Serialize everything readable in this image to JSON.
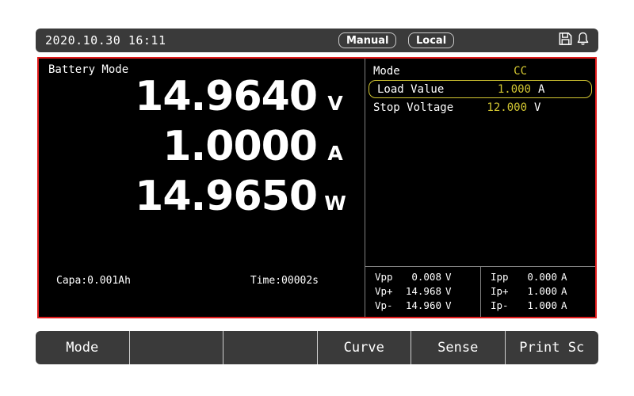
{
  "header": {
    "datetime": "2020.10.30 16:11",
    "mode_pill": "Manual",
    "control_pill": "Local",
    "icons": [
      {
        "name": "save-icon",
        "label": "save"
      },
      {
        "name": "bell-icon",
        "label": "alarm"
      }
    ]
  },
  "display": {
    "mode_title": "Battery Mode",
    "readings": [
      {
        "value": "14.9640",
        "unit": "V"
      },
      {
        "value": "1.0000",
        "unit": "A"
      },
      {
        "value": "14.9650",
        "unit": "W"
      }
    ],
    "stats": {
      "capacity": "Capa:0.001Ah",
      "time": "Time:00002s"
    },
    "parameters": [
      {
        "name": "Mode",
        "value": "CC",
        "unit": "",
        "selected": false
      },
      {
        "name": "Load Value",
        "value": "1.000",
        "unit": "A",
        "selected": true
      },
      {
        "name": "Stop Voltage",
        "value": "12.000",
        "unit": "V",
        "selected": false
      }
    ],
    "measurements": {
      "voltage": [
        {
          "key": "Vpp",
          "value": "0.008",
          "unit": "V"
        },
        {
          "key": "Vp+",
          "value": "14.968",
          "unit": "V"
        },
        {
          "key": "Vp-",
          "value": "14.960",
          "unit": "V"
        }
      ],
      "current": [
        {
          "key": "Ipp",
          "value": "0.000",
          "unit": "A"
        },
        {
          "key": "Ip+",
          "value": "1.000",
          "unit": "A"
        },
        {
          "key": "Ip-",
          "value": "1.000",
          "unit": "A"
        }
      ]
    }
  },
  "softkeys": [
    {
      "label": "Mode"
    },
    {
      "label": ""
    },
    {
      "label": ""
    },
    {
      "label": "Curve"
    },
    {
      "label": "Sense"
    },
    {
      "label": "Print Sc"
    }
  ],
  "colors": {
    "frame_red": "#e01b1b",
    "screen_black": "#000000",
    "bar_gray": "#3a3a3a",
    "value_yellow": "#d4c832",
    "text_white": "#ffffff",
    "divider_gray": "#808080"
  }
}
